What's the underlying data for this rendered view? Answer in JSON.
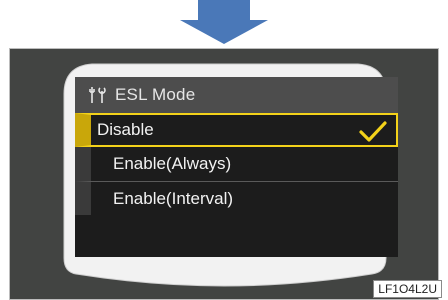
{
  "menu": {
    "title": "ESL Mode",
    "title_icon": "tools-icon",
    "items": [
      {
        "label": "Disable",
        "selected": true
      },
      {
        "label": "Enable(Always)",
        "selected": false
      },
      {
        "label": "Enable(Interval)",
        "selected": false
      }
    ]
  },
  "figure_code": "LF1O4L2U",
  "colors": {
    "arrow": "#4a78b8",
    "frame": "#424442",
    "highlight": "#f3d21a",
    "screen": "#1c1c1c",
    "title_bar": "#4d4d4d"
  }
}
